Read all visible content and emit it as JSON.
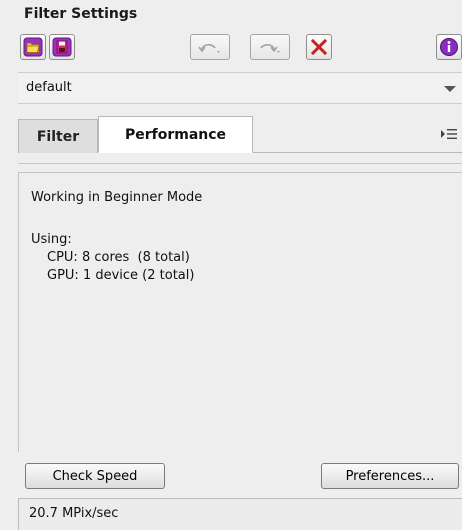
{
  "panel": {
    "title": "Filter Settings"
  },
  "toolbar": {
    "buttons": [
      {
        "name": "open",
        "icon": "folder-icon",
        "color": "#9b2fc7",
        "enabled": true
      },
      {
        "name": "save",
        "icon": "save-icon",
        "color": "#9b2fc7",
        "enabled": true
      },
      {
        "name": "undo",
        "icon": "undo-icon",
        "enabled": false
      },
      {
        "name": "redo",
        "icon": "redo-icon",
        "enabled": false
      },
      {
        "name": "reset",
        "icon": "close-icon",
        "color": "#cc1f1f",
        "enabled": true
      },
      {
        "name": "info",
        "icon": "info-icon",
        "color": "#8a2cc0",
        "enabled": true
      }
    ]
  },
  "preset": {
    "value": "default"
  },
  "tabs": [
    {
      "label": "Filter",
      "active": false
    },
    {
      "label": "Performance",
      "active": true
    }
  ],
  "content": {
    "mode": "Working in Beginner Mode",
    "using_label": "Using:",
    "cpu": "CPU: 8 cores  (8 total)",
    "gpu": "GPU: 1 device (2 total)"
  },
  "buttons": {
    "check_speed": "Check Speed",
    "preferences": "Preferences..."
  },
  "status": {
    "speed": "20.7 MPix/sec"
  }
}
